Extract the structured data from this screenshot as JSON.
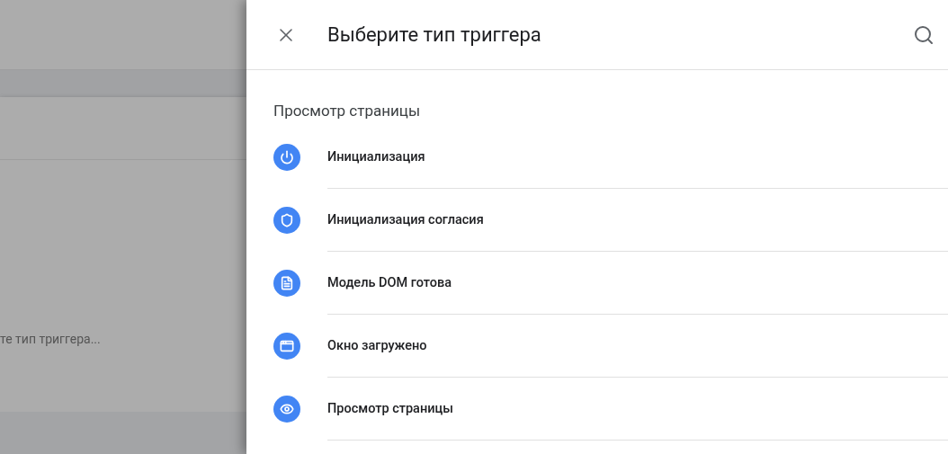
{
  "background": {
    "field_text": "те тип триггера..."
  },
  "panel": {
    "title": "Выберите тип триггера",
    "section": "Просмотр страницы",
    "items": [
      {
        "kind": "power",
        "label": "Инициализация"
      },
      {
        "kind": "shield",
        "label": "Инициализация согласия"
      },
      {
        "kind": "document",
        "label": "Модель DOM готова"
      },
      {
        "kind": "window",
        "label": "Окно загружено"
      },
      {
        "kind": "eye",
        "label": "Просмотр страницы"
      }
    ]
  }
}
